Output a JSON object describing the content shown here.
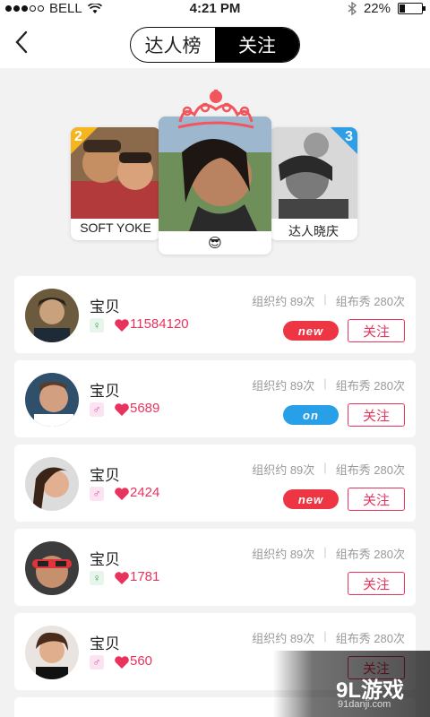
{
  "status_bar": {
    "carrier": "BELL",
    "time": "4:21 PM",
    "battery": "22%",
    "battery_level": 0.22
  },
  "header": {
    "back_icon": "chevron-left-icon",
    "tabs": [
      {
        "label": "达人榜",
        "active": false
      },
      {
        "label": "关注",
        "active": true
      }
    ]
  },
  "podium": {
    "first": {
      "emoji": "😎"
    },
    "second": {
      "rank": "2",
      "name": "SOFT YOKE"
    },
    "third": {
      "rank": "3",
      "name": "达人晓庆"
    }
  },
  "list": [
    {
      "name": "宝贝",
      "gender": "♀",
      "likes": "11584120",
      "meta1": "组织约 89次",
      "meta2": "组布秀 280次",
      "tag": "new",
      "follow": "关注"
    },
    {
      "name": "宝贝",
      "gender": "♂",
      "likes": "5689",
      "meta1": "组织约 89次",
      "meta2": "组布秀 280次",
      "tag": "on",
      "follow": "关注"
    },
    {
      "name": "宝贝",
      "gender": "♂",
      "likes": "2424",
      "meta1": "组织约 89次",
      "meta2": "组布秀 280次",
      "tag": "new",
      "follow": "关注"
    },
    {
      "name": "宝贝",
      "gender": "♀",
      "likes": "1781",
      "meta1": "组织约 89次",
      "meta2": "组布秀 280次",
      "tag": "",
      "follow": "关注"
    },
    {
      "name": "宝贝",
      "gender": "♂",
      "likes": "560",
      "meta1": "组织约 89次",
      "meta2": "组布秀 280次",
      "tag": "",
      "follow": "关注"
    }
  ],
  "watermark": {
    "title": "9L游戏",
    "url": "91danji.com"
  },
  "colors": {
    "accent": "#e8345d",
    "new_tag": "#ee3543",
    "on_tag": "#27a0e8",
    "rank2": "#f5b51e",
    "rank3": "#2e9fe6",
    "crown": "#f2555d"
  }
}
